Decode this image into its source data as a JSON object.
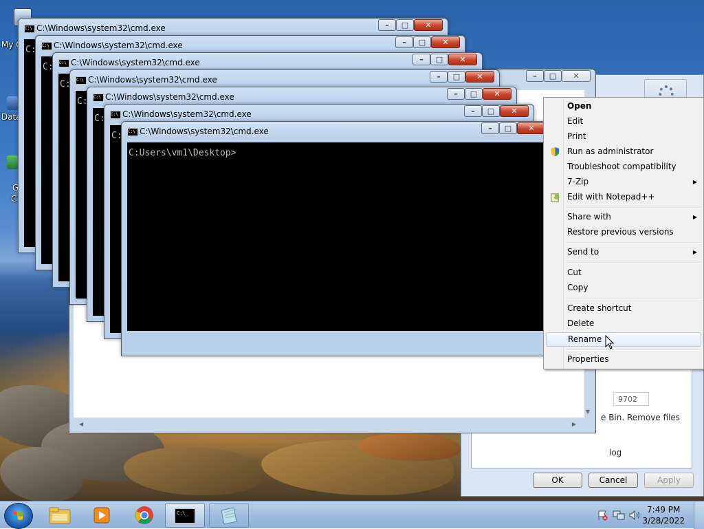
{
  "desktop": {
    "icons": [
      {
        "label": "My C"
      },
      {
        "label": "Data"
      },
      {
        "label": "G"
      },
      {
        "label": "C"
      }
    ]
  },
  "cmd_windows": [
    {
      "title": "C:\\Windows\\system32\\cmd.exe",
      "prompt": "C:"
    },
    {
      "title": "C:\\Windows\\system32\\cmd.exe",
      "prompt": "C:"
    },
    {
      "title": "C:\\Windows\\system32\\cmd.exe",
      "prompt": "C:"
    },
    {
      "title": "C:\\Windows\\system32\\cmd.exe",
      "prompt": "C:"
    },
    {
      "title": "C:\\Windows\\system32\\cmd.exe",
      "prompt": "C:"
    },
    {
      "title": "C:\\Windows\\system32\\cmd.exe",
      "prompt": "C:"
    },
    {
      "title": "C:\\Windows\\system32\\cmd.exe",
      "prompt": "C:Users\\vm1\\Desktop>"
    }
  ],
  "properties_dialog": {
    "field_value": "9702",
    "text_remove": "e Bin. Remove files",
    "text_log": "log",
    "ok_label": "OK",
    "cancel_label": "Cancel",
    "apply_label": "Apply"
  },
  "context_menu": {
    "items": [
      {
        "label": "Open",
        "bold": true
      },
      {
        "label": "Edit"
      },
      {
        "label": "Print"
      },
      {
        "label": "Run as administrator",
        "icon": "shield-icon"
      },
      {
        "label": "Troubleshoot compatibility"
      },
      {
        "label": "7-Zip",
        "submenu": true
      },
      {
        "label": "Edit with Notepad++",
        "icon": "notepadpp-icon"
      },
      {
        "label": "Share with",
        "submenu": true
      },
      {
        "label": "Restore previous versions"
      },
      {
        "label": "Send to",
        "submenu": true
      },
      {
        "label": "Cut"
      },
      {
        "label": "Copy"
      },
      {
        "label": "Create shortcut"
      },
      {
        "label": "Delete"
      },
      {
        "label": "Rename",
        "hovered": true
      },
      {
        "label": "Properties"
      }
    ]
  },
  "taskbar": {
    "time": "7:49 PM",
    "date": "3/28/2022",
    "pinned": [
      "explorer-icon",
      "media-player-icon",
      "chrome-icon",
      "cmd-icon",
      "notepad-icon"
    ],
    "active": "cmd-icon"
  },
  "colors": {
    "menu_hover": "#e3edfa",
    "close_button": "#c7432b",
    "titlebar": "#bcd2ec"
  }
}
